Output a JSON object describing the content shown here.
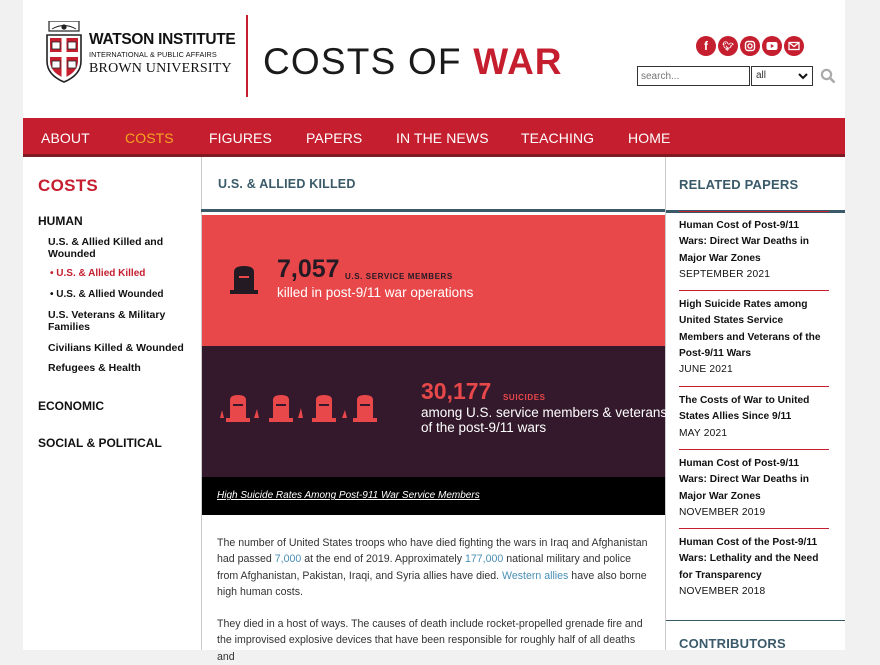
{
  "colors": {
    "brand_red": "#c41e2f",
    "accent_orange": "#f5a623",
    "slate": "#3a5a6a",
    "infographic_red": "#e9484a",
    "infographic_dark": "#33192b",
    "link_blue": "#4a8fb4"
  },
  "header": {
    "logo": {
      "line1": "WATSON INSTITUTE",
      "line2": "INTERNATIONAL & PUBLIC AFFAIRS",
      "line3": "BROWN UNIVERSITY"
    },
    "site_title": {
      "part1": "COSTS OF ",
      "part2": "WAR"
    },
    "social_icons": [
      "facebook-icon",
      "twitter-icon",
      "instagram-icon",
      "youtube-icon",
      "email-icon"
    ],
    "search": {
      "placeholder": "search...",
      "select_value": "all"
    }
  },
  "nav": {
    "items": [
      "ABOUT",
      "COSTS",
      "FIGURES",
      "PAPERS",
      "IN THE NEWS",
      "TEACHING",
      "HOME"
    ],
    "active": "COSTS"
  },
  "left_sidebar": {
    "title": "COSTS",
    "human": "HUMAN",
    "human_items": {
      "killed_wounded": "U.S. & Allied Killed and Wounded",
      "killed": "• U.S. & Allied Killed",
      "wounded": "• U.S. & Allied Wounded",
      "veterans": "U.S. Veterans & Military Families",
      "civilians": "Civilians Killed & Wounded",
      "refugees": "Refugees & Health"
    },
    "economic": "ECONOMIC",
    "social_political": "SOCIAL & POLITICAL"
  },
  "main": {
    "title": "U.S. & ALLIED KILLED",
    "stat1": {
      "number": "7,057",
      "unit": "U.S. SERVICE MEMBERS",
      "desc": "killed in post-9/11 war operations"
    },
    "stat2": {
      "number": "30,177",
      "unit": "SUICIDES",
      "desc1": "among U.S. service members & veterans",
      "desc2": "of the post-9/11 wars"
    },
    "caption_link": "High Suicide Rates Among Post-911 War Service Members",
    "para1": {
      "t1": "The number of United States troops who have died fighting the wars in Iraq and Afghanistan had passed ",
      "l1": "7,000",
      "t2": " at the end of 2019. Approximately ",
      "l2": "177,000",
      "t3": " national military and police from Afghanistan, Pakistan, Iraqi, and Syria allies have died. ",
      "l3": "Western allies",
      "t4": " have also borne high human costs."
    },
    "para2": "They died in a host of ways. The causes of death include rocket-propelled grenade fire and the improvised explosive devices that have been responsible for roughly half of all deaths and"
  },
  "right_sidebar": {
    "title": "RELATED PAPERS",
    "papers": [
      {
        "title": "Human Cost of Post-9/11 Wars: Direct War Deaths in Major War Zones",
        "date": "SEPTEMBER 2021"
      },
      {
        "title": "High Suicide Rates among United States Service Members and Veterans of the Post-9/11 Wars",
        "date": "JUNE 2021"
      },
      {
        "title": "The Costs of War to United States Allies Since 9/11",
        "date": "MAY 2021"
      },
      {
        "title": "Human Cost of Post-9/11 Wars: Direct War Deaths in Major War Zones",
        "date": "NOVEMBER 2019"
      },
      {
        "title": "Human Cost of the Post-9/11 Wars: Lethality and the Need for Transparency",
        "date": "NOVEMBER 2018"
      }
    ],
    "contributors": "CONTRIBUTORS"
  }
}
